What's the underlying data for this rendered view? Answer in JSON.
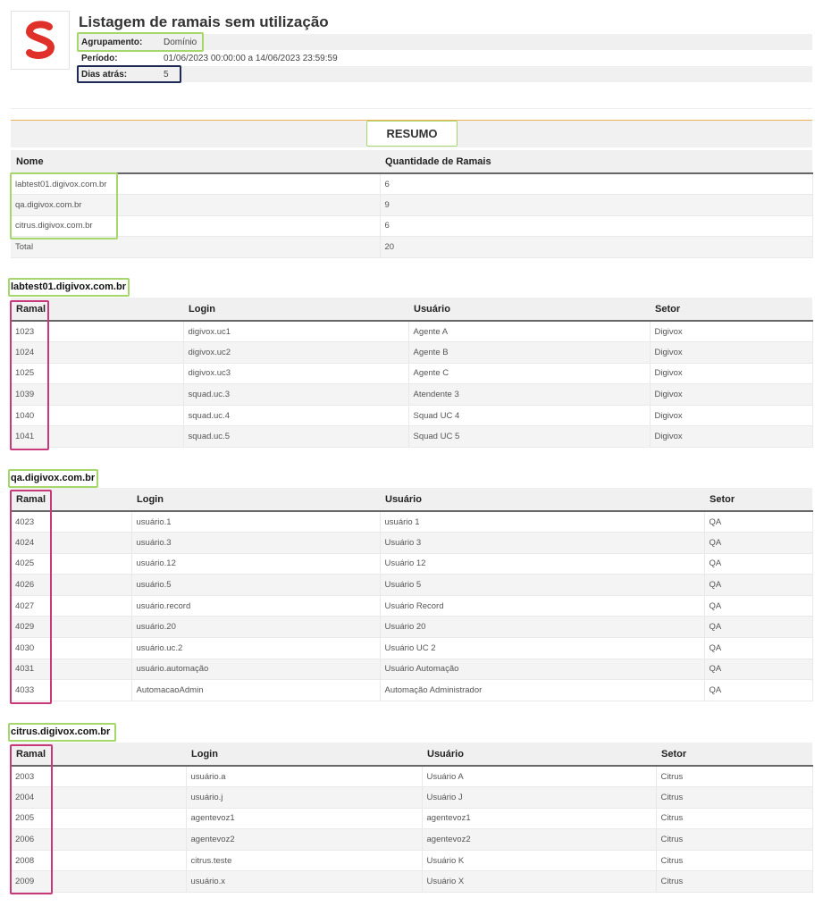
{
  "header": {
    "title": "Listagem de ramais sem utilização",
    "logo_letter": "S",
    "brand_color": "#e0302a",
    "meta": [
      {
        "label": "Agrupamento:",
        "value": "Domínio"
      },
      {
        "label": "Período:",
        "value": "01/06/2023 00:00:00 a 14/06/2023 23:59:59"
      },
      {
        "label": "Dias atrás:",
        "value": "5"
      }
    ]
  },
  "summary": {
    "label": "RESUMO",
    "columns": [
      "Nome",
      "Quantidade de Ramais"
    ],
    "rows": [
      [
        "labtest01.digivox.com.br",
        "6"
      ],
      [
        "qa.digivox.com.br",
        "9"
      ],
      [
        "citrus.digivox.com.br",
        "6"
      ],
      [
        "Total",
        "20"
      ]
    ]
  },
  "groups": [
    {
      "name": "labtest01.digivox.com.br",
      "columns": [
        "Ramal",
        "Login",
        "Usuário",
        "Setor"
      ],
      "rows": [
        [
          "1023",
          "digivox.uc1",
          "Agente A",
          "Digivox"
        ],
        [
          "1024",
          "digivox.uc2",
          "Agente B",
          "Digivox"
        ],
        [
          "1025",
          "digivox.uc3",
          "Agente C",
          "Digivox"
        ],
        [
          "1039",
          "squad.uc.3",
          "Atendente 3",
          "Digivox"
        ],
        [
          "1040",
          "squad.uc.4",
          "Squad UC 4",
          "Digivox"
        ],
        [
          "1041",
          "squad.uc.5",
          "Squad UC 5",
          "Digivox"
        ]
      ]
    },
    {
      "name": "qa.digivox.com.br",
      "columns": [
        "Ramal",
        "Login",
        "Usuário",
        "Setor"
      ],
      "rows": [
        [
          "4023",
          "usuário.1",
          "usuário 1",
          "QA"
        ],
        [
          "4024",
          "usuário.3",
          "Usuário 3",
          "QA"
        ],
        [
          "4025",
          "usuário.12",
          "Usuário 12",
          "QA"
        ],
        [
          "4026",
          "usuário.5",
          "Usuário 5",
          "QA"
        ],
        [
          "4027",
          "usuário.record",
          "Usuário Record",
          "QA"
        ],
        [
          "4029",
          "usuário.20",
          "Usuário 20",
          "QA"
        ],
        [
          "4030",
          "usuário.uc.2",
          "Usuário UC 2",
          "QA"
        ],
        [
          "4031",
          "usuário.automação",
          "Usuário Automação",
          "QA"
        ],
        [
          "4033",
          "AutomacaoAdmin",
          "Automação Administrador",
          "QA"
        ]
      ]
    },
    {
      "name": "citrus.digivox.com.br",
      "columns": [
        "Ramal",
        "Login",
        "Usuário",
        "Setor"
      ],
      "rows": [
        [
          "2003",
          "usuário.a",
          "Usuário A",
          "Citrus"
        ],
        [
          "2004",
          "usuário.j",
          "Usuário J",
          "Citrus"
        ],
        [
          "2005",
          "agentevoz1",
          "agentevoz1",
          "Citrus"
        ],
        [
          "2006",
          "agentevoz2",
          "agentevoz2",
          "Citrus"
        ],
        [
          "2008",
          "citrus.teste",
          "Usuário K",
          "Citrus"
        ],
        [
          "2009",
          "usuário.x",
          "Usuário X",
          "Citrus"
        ]
      ]
    }
  ]
}
